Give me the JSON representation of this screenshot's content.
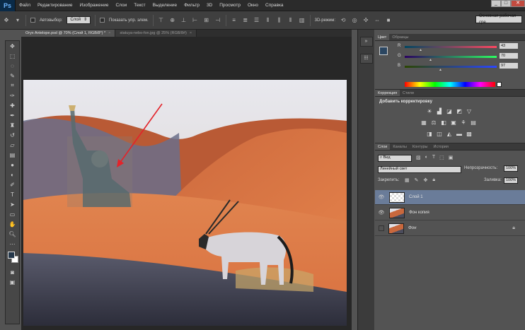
{
  "app": {
    "logo": "Ps"
  },
  "menu": [
    "Файл",
    "Редактирование",
    "Изображение",
    "Слои",
    "Текст",
    "Выделение",
    "Фильтр",
    "3D",
    "Просмотр",
    "Окно",
    "Справка"
  ],
  "window_controls": {
    "minimize": "_",
    "maximize": "□",
    "close": "✕"
  },
  "options_bar": {
    "autoselect_label": "Автовыбор:",
    "autoselect_value": "Слой",
    "show_controls_label": "Показать упр. элем.",
    "mode_3d_label": "3D-режим:",
    "workspace": "Основная рабочая сре"
  },
  "doc_tabs": [
    {
      "label": "Oryx Antelope.psd @ 70% (Слой 1, RGB/8*) *",
      "close": "×"
    },
    {
      "label": "statuya-nebo-fon.jpg @ 25% (RGB/8#)",
      "close": "×"
    }
  ],
  "color_panel": {
    "tabs": [
      "Цвет",
      "Образцы"
    ],
    "r_label": "R",
    "g_label": "G",
    "b_label": "B",
    "r": "43",
    "g": "70",
    "b": "97",
    "fg_color": "#2b4661"
  },
  "adjustments_panel": {
    "tabs": [
      "Коррекция",
      "Стили"
    ],
    "title": "Добавить корректировку"
  },
  "layers_panel": {
    "tabs": [
      "Слои",
      "Каналы",
      "Контуры",
      "История"
    ],
    "kind_label": "Вид",
    "blend_mode": "Линейный свет",
    "opacity_label": "Непрозрачность:",
    "opacity": "100%",
    "lock_label": "Закрепить:",
    "fill_label": "Заливка:",
    "fill": "100%",
    "layers": [
      {
        "name": "Слой 1",
        "visible": true,
        "selected": true
      },
      {
        "name": "Фон копия",
        "visible": true,
        "selected": false
      },
      {
        "name": "Фон",
        "visible": false,
        "selected": false
      }
    ]
  }
}
